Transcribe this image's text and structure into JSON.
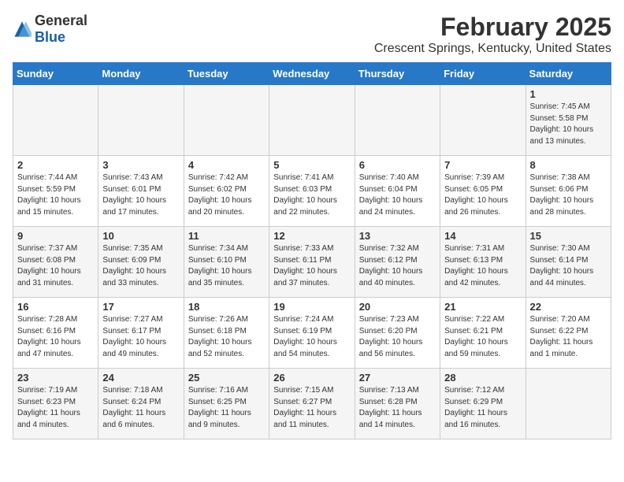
{
  "header": {
    "logo_general": "General",
    "logo_blue": "Blue",
    "month_title": "February 2025",
    "location": "Crescent Springs, Kentucky, United States"
  },
  "weekdays": [
    "Sunday",
    "Monday",
    "Tuesday",
    "Wednesday",
    "Thursday",
    "Friday",
    "Saturday"
  ],
  "weeks": [
    [
      {
        "day": "",
        "info": ""
      },
      {
        "day": "",
        "info": ""
      },
      {
        "day": "",
        "info": ""
      },
      {
        "day": "",
        "info": ""
      },
      {
        "day": "",
        "info": ""
      },
      {
        "day": "",
        "info": ""
      },
      {
        "day": "1",
        "info": "Sunrise: 7:45 AM\nSunset: 5:58 PM\nDaylight: 10 hours\nand 13 minutes."
      }
    ],
    [
      {
        "day": "2",
        "info": "Sunrise: 7:44 AM\nSunset: 5:59 PM\nDaylight: 10 hours\nand 15 minutes."
      },
      {
        "day": "3",
        "info": "Sunrise: 7:43 AM\nSunset: 6:01 PM\nDaylight: 10 hours\nand 17 minutes."
      },
      {
        "day": "4",
        "info": "Sunrise: 7:42 AM\nSunset: 6:02 PM\nDaylight: 10 hours\nand 20 minutes."
      },
      {
        "day": "5",
        "info": "Sunrise: 7:41 AM\nSunset: 6:03 PM\nDaylight: 10 hours\nand 22 minutes."
      },
      {
        "day": "6",
        "info": "Sunrise: 7:40 AM\nSunset: 6:04 PM\nDaylight: 10 hours\nand 24 minutes."
      },
      {
        "day": "7",
        "info": "Sunrise: 7:39 AM\nSunset: 6:05 PM\nDaylight: 10 hours\nand 26 minutes."
      },
      {
        "day": "8",
        "info": "Sunrise: 7:38 AM\nSunset: 6:06 PM\nDaylight: 10 hours\nand 28 minutes."
      }
    ],
    [
      {
        "day": "9",
        "info": "Sunrise: 7:37 AM\nSunset: 6:08 PM\nDaylight: 10 hours\nand 31 minutes."
      },
      {
        "day": "10",
        "info": "Sunrise: 7:35 AM\nSunset: 6:09 PM\nDaylight: 10 hours\nand 33 minutes."
      },
      {
        "day": "11",
        "info": "Sunrise: 7:34 AM\nSunset: 6:10 PM\nDaylight: 10 hours\nand 35 minutes."
      },
      {
        "day": "12",
        "info": "Sunrise: 7:33 AM\nSunset: 6:11 PM\nDaylight: 10 hours\nand 37 minutes."
      },
      {
        "day": "13",
        "info": "Sunrise: 7:32 AM\nSunset: 6:12 PM\nDaylight: 10 hours\nand 40 minutes."
      },
      {
        "day": "14",
        "info": "Sunrise: 7:31 AM\nSunset: 6:13 PM\nDaylight: 10 hours\nand 42 minutes."
      },
      {
        "day": "15",
        "info": "Sunrise: 7:30 AM\nSunset: 6:14 PM\nDaylight: 10 hours\nand 44 minutes."
      }
    ],
    [
      {
        "day": "16",
        "info": "Sunrise: 7:28 AM\nSunset: 6:16 PM\nDaylight: 10 hours\nand 47 minutes."
      },
      {
        "day": "17",
        "info": "Sunrise: 7:27 AM\nSunset: 6:17 PM\nDaylight: 10 hours\nand 49 minutes."
      },
      {
        "day": "18",
        "info": "Sunrise: 7:26 AM\nSunset: 6:18 PM\nDaylight: 10 hours\nand 52 minutes."
      },
      {
        "day": "19",
        "info": "Sunrise: 7:24 AM\nSunset: 6:19 PM\nDaylight: 10 hours\nand 54 minutes."
      },
      {
        "day": "20",
        "info": "Sunrise: 7:23 AM\nSunset: 6:20 PM\nDaylight: 10 hours\nand 56 minutes."
      },
      {
        "day": "21",
        "info": "Sunrise: 7:22 AM\nSunset: 6:21 PM\nDaylight: 10 hours\nand 59 minutes."
      },
      {
        "day": "22",
        "info": "Sunrise: 7:20 AM\nSunset: 6:22 PM\nDaylight: 11 hours\nand 1 minute."
      }
    ],
    [
      {
        "day": "23",
        "info": "Sunrise: 7:19 AM\nSunset: 6:23 PM\nDaylight: 11 hours\nand 4 minutes."
      },
      {
        "day": "24",
        "info": "Sunrise: 7:18 AM\nSunset: 6:24 PM\nDaylight: 11 hours\nand 6 minutes."
      },
      {
        "day": "25",
        "info": "Sunrise: 7:16 AM\nSunset: 6:25 PM\nDaylight: 11 hours\nand 9 minutes."
      },
      {
        "day": "26",
        "info": "Sunrise: 7:15 AM\nSunset: 6:27 PM\nDaylight: 11 hours\nand 11 minutes."
      },
      {
        "day": "27",
        "info": "Sunrise: 7:13 AM\nSunset: 6:28 PM\nDaylight: 11 hours\nand 14 minutes."
      },
      {
        "day": "28",
        "info": "Sunrise: 7:12 AM\nSunset: 6:29 PM\nDaylight: 11 hours\nand 16 minutes."
      },
      {
        "day": "",
        "info": ""
      }
    ]
  ]
}
